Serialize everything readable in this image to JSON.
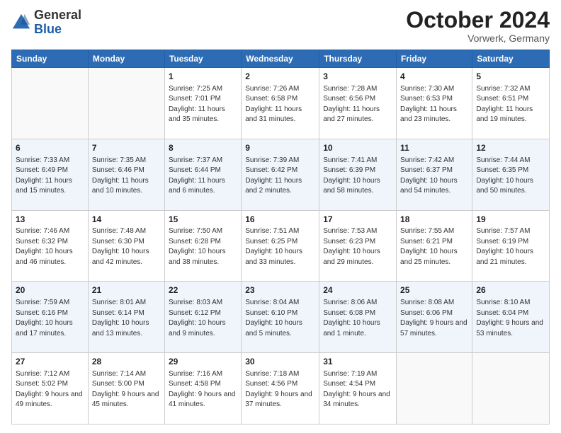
{
  "header": {
    "logo_general": "General",
    "logo_blue": "Blue",
    "month": "October 2024",
    "location": "Vorwerk, Germany"
  },
  "days_of_week": [
    "Sunday",
    "Monday",
    "Tuesday",
    "Wednesday",
    "Thursday",
    "Friday",
    "Saturday"
  ],
  "weeks": [
    [
      {
        "day": "",
        "sunrise": "",
        "sunset": "",
        "daylight": ""
      },
      {
        "day": "",
        "sunrise": "",
        "sunset": "",
        "daylight": ""
      },
      {
        "day": "1",
        "sunrise": "Sunrise: 7:25 AM",
        "sunset": "Sunset: 7:01 PM",
        "daylight": "Daylight: 11 hours and 35 minutes."
      },
      {
        "day": "2",
        "sunrise": "Sunrise: 7:26 AM",
        "sunset": "Sunset: 6:58 PM",
        "daylight": "Daylight: 11 hours and 31 minutes."
      },
      {
        "day": "3",
        "sunrise": "Sunrise: 7:28 AM",
        "sunset": "Sunset: 6:56 PM",
        "daylight": "Daylight: 11 hours and 27 minutes."
      },
      {
        "day": "4",
        "sunrise": "Sunrise: 7:30 AM",
        "sunset": "Sunset: 6:53 PM",
        "daylight": "Daylight: 11 hours and 23 minutes."
      },
      {
        "day": "5",
        "sunrise": "Sunrise: 7:32 AM",
        "sunset": "Sunset: 6:51 PM",
        "daylight": "Daylight: 11 hours and 19 minutes."
      }
    ],
    [
      {
        "day": "6",
        "sunrise": "Sunrise: 7:33 AM",
        "sunset": "Sunset: 6:49 PM",
        "daylight": "Daylight: 11 hours and 15 minutes."
      },
      {
        "day": "7",
        "sunrise": "Sunrise: 7:35 AM",
        "sunset": "Sunset: 6:46 PM",
        "daylight": "Daylight: 11 hours and 10 minutes."
      },
      {
        "day": "8",
        "sunrise": "Sunrise: 7:37 AM",
        "sunset": "Sunset: 6:44 PM",
        "daylight": "Daylight: 11 hours and 6 minutes."
      },
      {
        "day": "9",
        "sunrise": "Sunrise: 7:39 AM",
        "sunset": "Sunset: 6:42 PM",
        "daylight": "Daylight: 11 hours and 2 minutes."
      },
      {
        "day": "10",
        "sunrise": "Sunrise: 7:41 AM",
        "sunset": "Sunset: 6:39 PM",
        "daylight": "Daylight: 10 hours and 58 minutes."
      },
      {
        "day": "11",
        "sunrise": "Sunrise: 7:42 AM",
        "sunset": "Sunset: 6:37 PM",
        "daylight": "Daylight: 10 hours and 54 minutes."
      },
      {
        "day": "12",
        "sunrise": "Sunrise: 7:44 AM",
        "sunset": "Sunset: 6:35 PM",
        "daylight": "Daylight: 10 hours and 50 minutes."
      }
    ],
    [
      {
        "day": "13",
        "sunrise": "Sunrise: 7:46 AM",
        "sunset": "Sunset: 6:32 PM",
        "daylight": "Daylight: 10 hours and 46 minutes."
      },
      {
        "day": "14",
        "sunrise": "Sunrise: 7:48 AM",
        "sunset": "Sunset: 6:30 PM",
        "daylight": "Daylight: 10 hours and 42 minutes."
      },
      {
        "day": "15",
        "sunrise": "Sunrise: 7:50 AM",
        "sunset": "Sunset: 6:28 PM",
        "daylight": "Daylight: 10 hours and 38 minutes."
      },
      {
        "day": "16",
        "sunrise": "Sunrise: 7:51 AM",
        "sunset": "Sunset: 6:25 PM",
        "daylight": "Daylight: 10 hours and 33 minutes."
      },
      {
        "day": "17",
        "sunrise": "Sunrise: 7:53 AM",
        "sunset": "Sunset: 6:23 PM",
        "daylight": "Daylight: 10 hours and 29 minutes."
      },
      {
        "day": "18",
        "sunrise": "Sunrise: 7:55 AM",
        "sunset": "Sunset: 6:21 PM",
        "daylight": "Daylight: 10 hours and 25 minutes."
      },
      {
        "day": "19",
        "sunrise": "Sunrise: 7:57 AM",
        "sunset": "Sunset: 6:19 PM",
        "daylight": "Daylight: 10 hours and 21 minutes."
      }
    ],
    [
      {
        "day": "20",
        "sunrise": "Sunrise: 7:59 AM",
        "sunset": "Sunset: 6:16 PM",
        "daylight": "Daylight: 10 hours and 17 minutes."
      },
      {
        "day": "21",
        "sunrise": "Sunrise: 8:01 AM",
        "sunset": "Sunset: 6:14 PM",
        "daylight": "Daylight: 10 hours and 13 minutes."
      },
      {
        "day": "22",
        "sunrise": "Sunrise: 8:03 AM",
        "sunset": "Sunset: 6:12 PM",
        "daylight": "Daylight: 10 hours and 9 minutes."
      },
      {
        "day": "23",
        "sunrise": "Sunrise: 8:04 AM",
        "sunset": "Sunset: 6:10 PM",
        "daylight": "Daylight: 10 hours and 5 minutes."
      },
      {
        "day": "24",
        "sunrise": "Sunrise: 8:06 AM",
        "sunset": "Sunset: 6:08 PM",
        "daylight": "Daylight: 10 hours and 1 minute."
      },
      {
        "day": "25",
        "sunrise": "Sunrise: 8:08 AM",
        "sunset": "Sunset: 6:06 PM",
        "daylight": "Daylight: 9 hours and 57 minutes."
      },
      {
        "day": "26",
        "sunrise": "Sunrise: 8:10 AM",
        "sunset": "Sunset: 6:04 PM",
        "daylight": "Daylight: 9 hours and 53 minutes."
      }
    ],
    [
      {
        "day": "27",
        "sunrise": "Sunrise: 7:12 AM",
        "sunset": "Sunset: 5:02 PM",
        "daylight": "Daylight: 9 hours and 49 minutes."
      },
      {
        "day": "28",
        "sunrise": "Sunrise: 7:14 AM",
        "sunset": "Sunset: 5:00 PM",
        "daylight": "Daylight: 9 hours and 45 minutes."
      },
      {
        "day": "29",
        "sunrise": "Sunrise: 7:16 AM",
        "sunset": "Sunset: 4:58 PM",
        "daylight": "Daylight: 9 hours and 41 minutes."
      },
      {
        "day": "30",
        "sunrise": "Sunrise: 7:18 AM",
        "sunset": "Sunset: 4:56 PM",
        "daylight": "Daylight: 9 hours and 37 minutes."
      },
      {
        "day": "31",
        "sunrise": "Sunrise: 7:19 AM",
        "sunset": "Sunset: 4:54 PM",
        "daylight": "Daylight: 9 hours and 34 minutes."
      },
      {
        "day": "",
        "sunrise": "",
        "sunset": "",
        "daylight": ""
      },
      {
        "day": "",
        "sunrise": "",
        "sunset": "",
        "daylight": ""
      }
    ]
  ]
}
